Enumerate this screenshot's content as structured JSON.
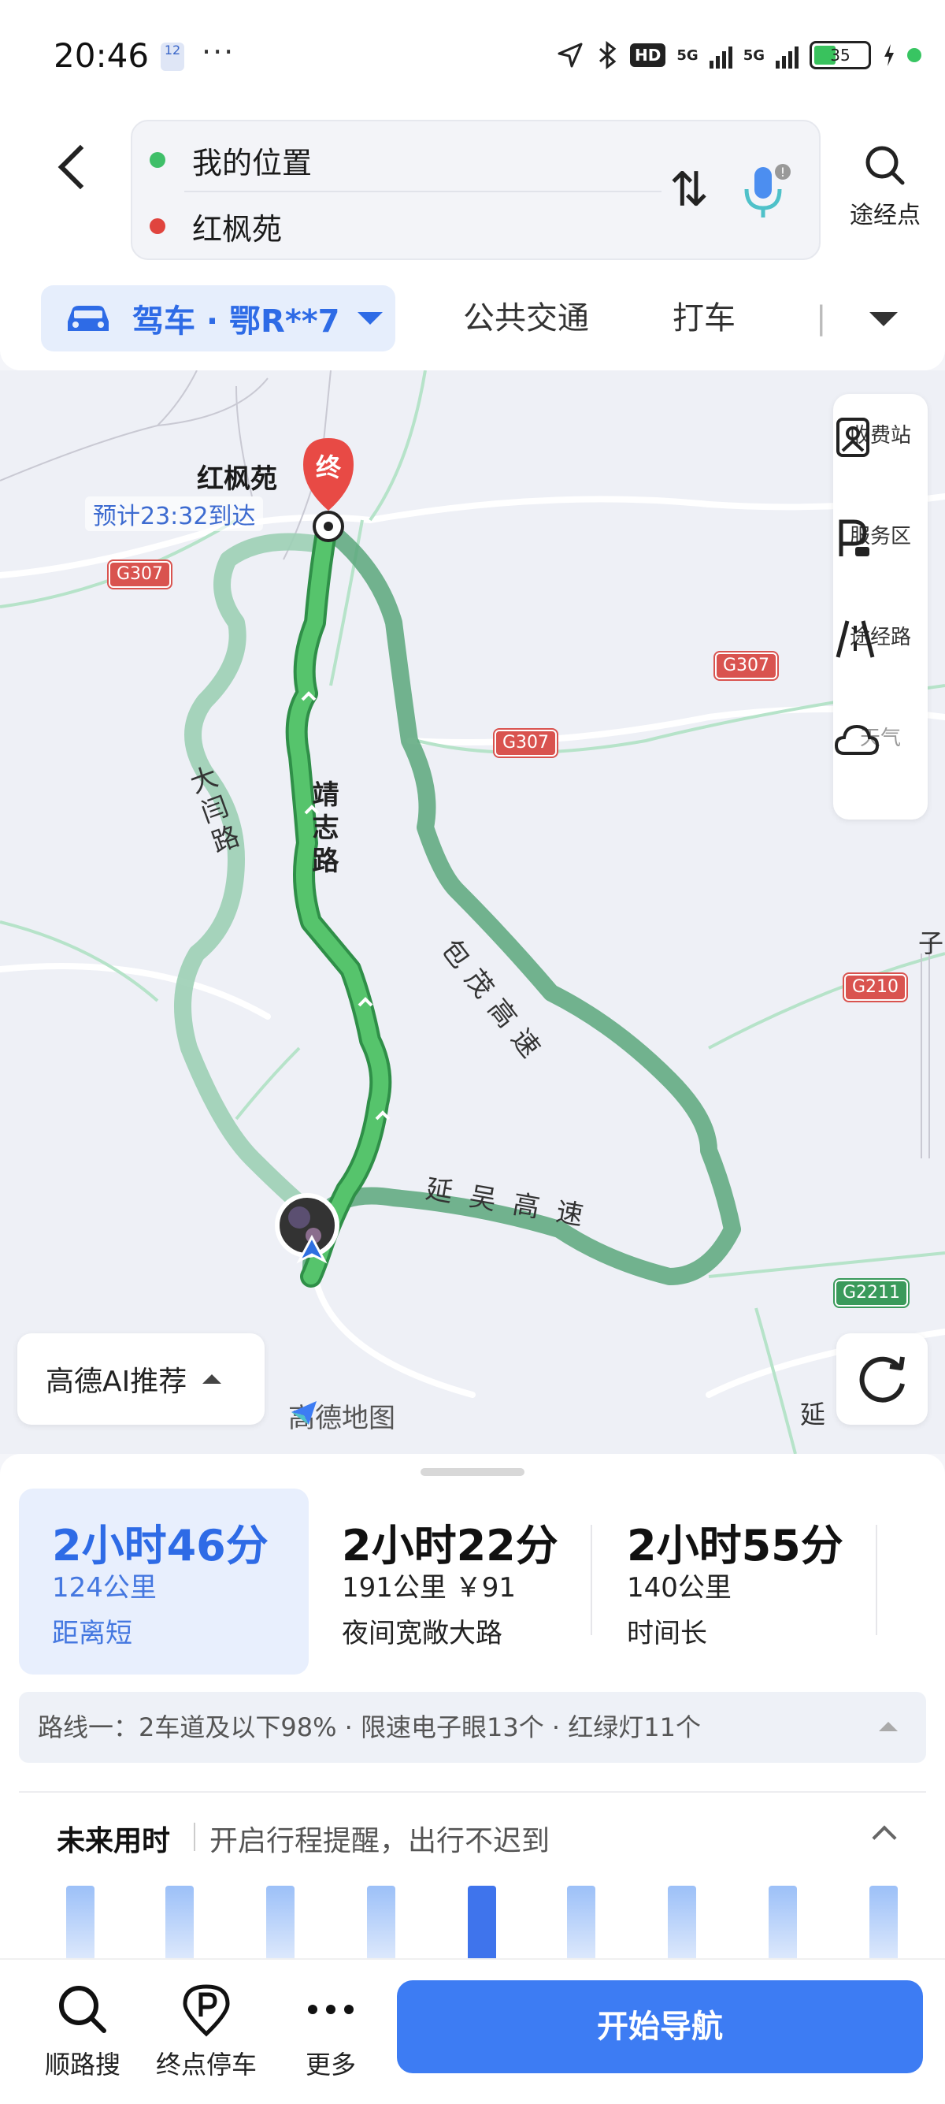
{
  "status": {
    "time": "20:46",
    "notif_badge": "12",
    "network1": "5G",
    "network2": "5G",
    "battery": "35"
  },
  "header": {
    "origin": "我的位置",
    "destination": "红枫苑",
    "waypoint_label": "途经点"
  },
  "modes": {
    "active": "驾车 · 鄂R**7",
    "items": [
      "公共交通",
      "打车"
    ]
  },
  "map": {
    "dest_name": "红枫苑",
    "dest_pin": "终",
    "eta": "预计23:32到达",
    "roads": {
      "main": "靖志路",
      "west": "大闫路",
      "east": "包茂高速",
      "south": "延吴高速"
    },
    "highway_badges": [
      "G307",
      "G307",
      "G307",
      "G210",
      "G2211"
    ],
    "edge_texts": [
      "子",
      "延"
    ],
    "tools": [
      "收费站",
      "服务区",
      "途经路",
      "天气"
    ],
    "ai_label": "高德AI推荐",
    "brand": "高德地图"
  },
  "routes": [
    {
      "duration": "2小时46分",
      "distance": "124公里",
      "tag": "距离短"
    },
    {
      "duration": "2小时22分",
      "distance": "191公里 ￥91",
      "tag": "夜间宽敞大路"
    },
    {
      "duration": "2小时55分",
      "distance": "140公里",
      "tag": "时间长"
    }
  ],
  "route_info": "路线一：2车道及以下98% · 限速电子眼13个 · 红绿灯11个",
  "future": {
    "title": "未来用时",
    "desc": "开启行程提醒，出行不迟到"
  },
  "bottom": {
    "search_along": "顺路搜",
    "dest_parking": "终点停车",
    "more": "更多",
    "start": "开始导航"
  },
  "colors": {
    "accent": "#3d7cf3",
    "route_main": "#3fae59",
    "route_alt": "#7cc4a2"
  }
}
